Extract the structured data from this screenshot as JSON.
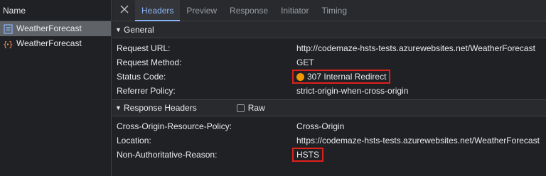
{
  "colors": {
    "status_dot": "#f29900",
    "highlight_box": "#e0201b",
    "active_tab": "#8ab4f8"
  },
  "left": {
    "header": "Name",
    "items": [
      {
        "label": "WeatherForecast",
        "icon": "document-icon",
        "selected": true
      },
      {
        "label": "WeatherForecast",
        "icon": "fetch-xhr-icon",
        "selected": false
      }
    ]
  },
  "tabs": [
    {
      "label": "Headers",
      "active": true
    },
    {
      "label": "Preview",
      "active": false
    },
    {
      "label": "Response",
      "active": false
    },
    {
      "label": "Initiator",
      "active": false
    },
    {
      "label": "Timing",
      "active": false
    }
  ],
  "general": {
    "title": "General",
    "rows": [
      {
        "key": "Request URL:",
        "value": "http://codemaze-hsts-tests.azurewebsites.net/WeatherForecast"
      },
      {
        "key": "Request Method:",
        "value": "GET"
      },
      {
        "key": "Status Code:",
        "value": "307 Internal Redirect"
      },
      {
        "key": "Referrer Policy:",
        "value": "strict-origin-when-cross-origin"
      }
    ]
  },
  "response_headers": {
    "title": "Response Headers",
    "raw_label": "Raw",
    "raw_checked": false,
    "rows": [
      {
        "key": "Cross-Origin-Resource-Policy:",
        "value": "Cross-Origin"
      },
      {
        "key": "Location:",
        "value": "https://codemaze-hsts-tests.azurewebsites.net/WeatherForecast"
      },
      {
        "key": "Non-Authoritative-Reason:",
        "value": "HSTS"
      }
    ]
  }
}
